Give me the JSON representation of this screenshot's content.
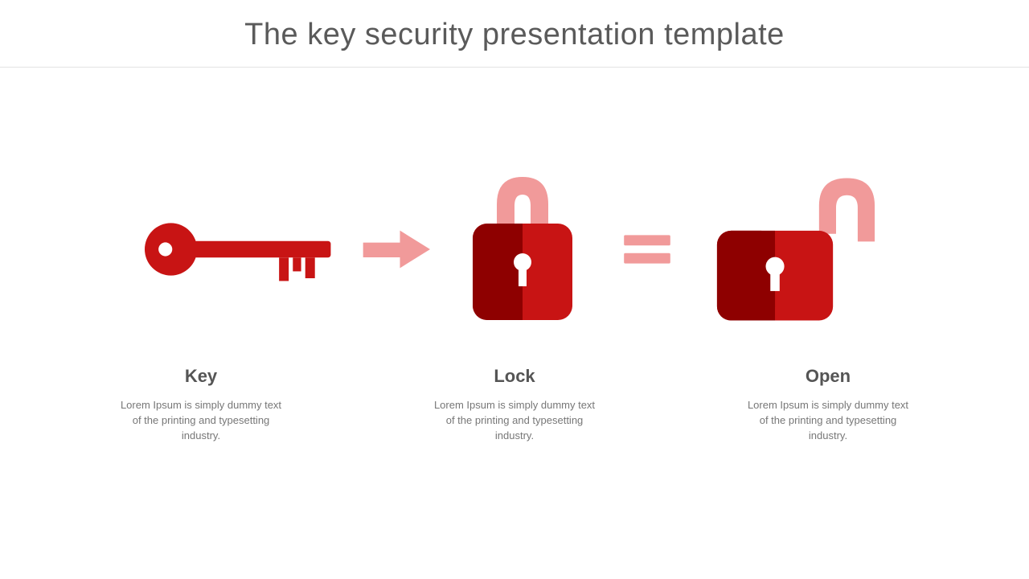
{
  "title": "The key security presentation template",
  "colors": {
    "red": "#c81414",
    "darkRed": "#8e0000",
    "pink": "#f19a9a"
  },
  "items": [
    {
      "icon": "key",
      "label": "Key",
      "desc": "Lorem Ipsum is simply dummy text of the printing and typesetting industry."
    },
    {
      "icon": "lock",
      "label": "Lock",
      "desc": "Lorem Ipsum is simply dummy text of the printing and typesetting industry."
    },
    {
      "icon": "open-lock",
      "label": "Open",
      "desc": "Lorem Ipsum is simply dummy text of the printing and typesetting industry."
    }
  ],
  "connectors": [
    "arrow",
    "equals"
  ]
}
